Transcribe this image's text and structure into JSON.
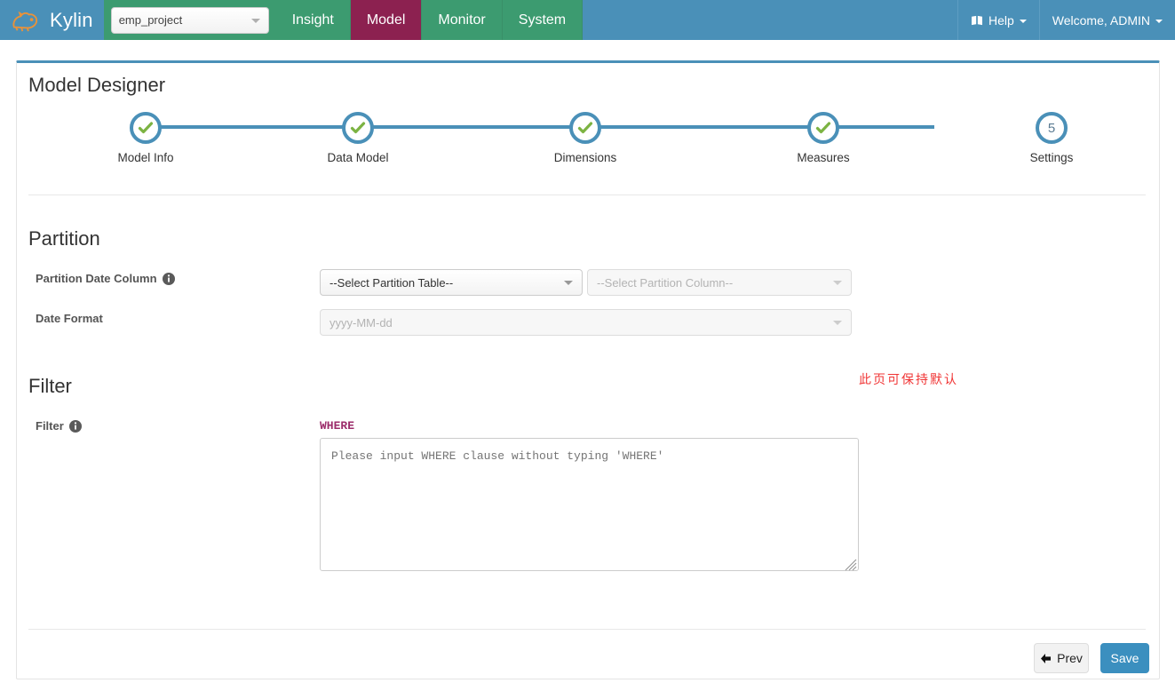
{
  "navbar": {
    "brand": "Kylin",
    "brand_logo_icon": "kylin-logo-icon",
    "project_value": "emp_project",
    "project_caret_icon": "chevron-down-icon",
    "tabs": [
      {
        "label": "Insight",
        "active": false
      },
      {
        "label": "Model",
        "active": true
      },
      {
        "label": "Monitor",
        "active": false
      },
      {
        "label": "System",
        "active": false
      }
    ],
    "help_label": "Help",
    "help_icon": "book-icon",
    "help_caret_icon": "chevron-down-icon",
    "user_label": "Welcome, ADMIN",
    "user_caret_icon": "chevron-down-icon",
    "colors": {
      "navbar_bg": "#4a90b8",
      "nav_tab_bg": "#3c9b70",
      "nav_tab_active_bg": "#8c2150"
    }
  },
  "page": {
    "title": "Model Designer",
    "accent": "#4a90b8"
  },
  "stepper": {
    "steps": [
      {
        "label": "Model Info",
        "state": "done",
        "number": "1",
        "icon": "check-icon"
      },
      {
        "label": "Data Model",
        "state": "done",
        "number": "2",
        "icon": "check-icon"
      },
      {
        "label": "Dimensions",
        "state": "done",
        "number": "3",
        "icon": "check-icon"
      },
      {
        "label": "Measures",
        "state": "done",
        "number": "4",
        "icon": "check-icon"
      },
      {
        "label": "Settings",
        "state": "current",
        "number": "5",
        "icon": ""
      }
    ],
    "check_color": "#7cb342",
    "ring_color": "#4a90b8"
  },
  "partition": {
    "title": "Partition",
    "date_column_label": "Partition Date Column",
    "date_column_info_icon": "info-icon",
    "partition_table_value": "--Select Partition Table--",
    "partition_column_value": "--Select Partition Column--",
    "date_format_label": "Date Format",
    "date_format_value": "yyyy-MM-dd",
    "caret_icon": "chevron-down-icon"
  },
  "filter": {
    "title": "Filter",
    "label": "Filter",
    "info_icon": "info-icon",
    "where_label": "WHERE",
    "textarea_placeholder": "Please input WHERE clause without typing 'WHERE'",
    "textarea_value": "",
    "resize_grip_icon": "resize-grip-icon"
  },
  "annotation": {
    "text": "此页可保持默认",
    "color": "#f03434"
  },
  "footer": {
    "prev_label": "Prev",
    "prev_icon": "arrow-left-icon",
    "save_label": "Save",
    "save_color": "#3b8fbf"
  }
}
